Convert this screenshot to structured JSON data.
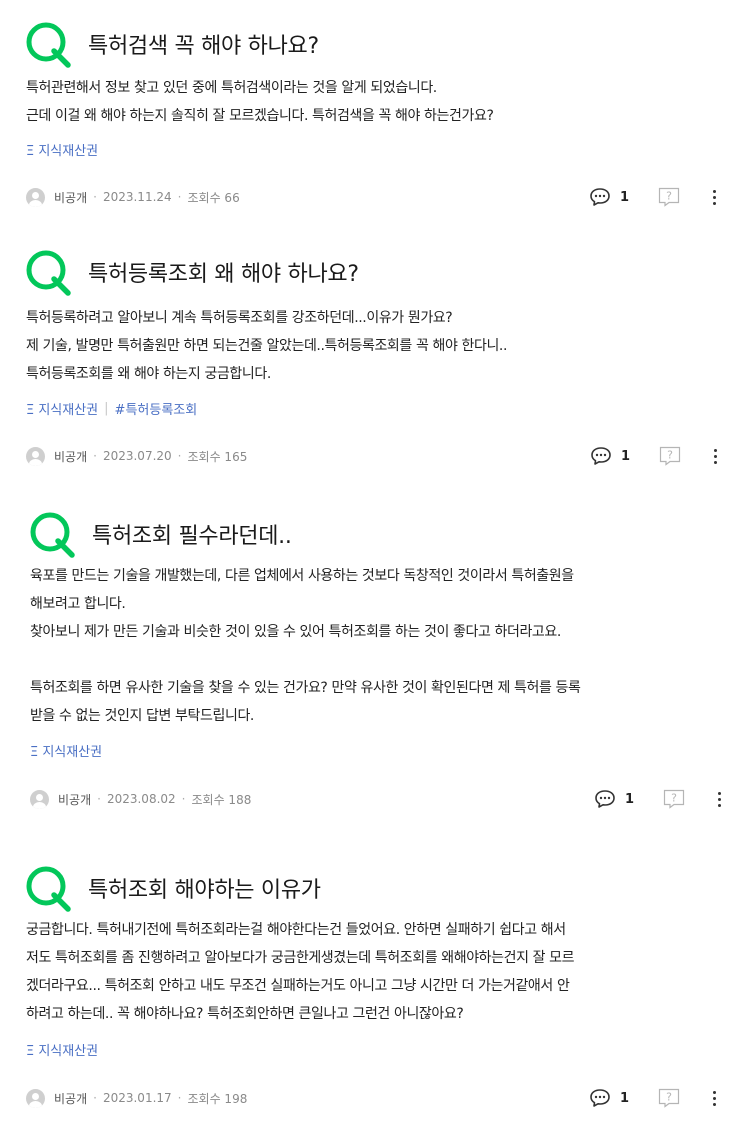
{
  "colors": {
    "accent_green": "#03c75a",
    "tag_blue": "#4a6fc4",
    "meta_gray": "#8a8a8a"
  },
  "icons": {
    "question_mark": "q-logo-icon",
    "answer": "speech-bubble-icon",
    "help": "question-box-icon",
    "more": "kebab-menu-icon",
    "avatar": "default-profile-icon"
  },
  "posts": [
    {
      "title": "특허검색 꼭 해야 하나요?",
      "body": [
        "특허관련해서 정보 찾고 있던 중에 특허검색이라는 것을 알게 되었습니다.",
        "근데 이걸 왜 해야 하는지 솔직히 잘 모르겠습니다. 특허검색을 꼭 해야 하는건가요?"
      ],
      "tags": [
        "Ξ 지식재산권"
      ],
      "author": "비공개",
      "date": "2023.11.24",
      "views": "조회수 66",
      "answers": "1"
    },
    {
      "title": "특허등록조회 왜 해야 하나요?",
      "body": [
        "특허등록하려고 알아보니 계속 특허등록조회를 강조하던데...이유가 뭔가요?",
        "제 기술, 발명만 특허출원만 하면 되는건줄 알았는데..특허등록조회를 꼭 해야 한다니..",
        "특허등록조회를 왜 해야 하는지 궁금합니다."
      ],
      "tags": [
        "Ξ 지식재산권",
        "#특허등록조회"
      ],
      "author": "비공개",
      "date": "2023.07.20",
      "views": "조회수 165",
      "answers": "1"
    },
    {
      "title": "특허조회 필수라던데..",
      "body": [
        "육포를 만드는 기술을 개발했는데, 다른 업체에서 사용하는 것보다 독창적인 것이라서 특허출원을",
        "해보려고 합니다.",
        "찾아보니 제가 만든 기술과 비슷한 것이 있을 수 있어 특허조회를 하는 것이 좋다고 하더라고요.",
        "",
        "특허조회를 하면 유사한 기술을 찾을 수 있는 건가요? 만약 유사한 것이 확인된다면 제 특허를 등록",
        "받을 수 없는 것인지 답변 부탁드립니다."
      ],
      "tags": [
        "Ξ 지식재산권"
      ],
      "author": "비공개",
      "date": "2023.08.02",
      "views": "조회수 188",
      "answers": "1"
    },
    {
      "title": "특허조회 해야하는 이유가",
      "body": [
        "궁금합니다. 특허내기전에 특허조회라는걸 해야한다는건 들었어요.  안하면 실패하기 쉽다고 해서",
        "저도 특허조회를 좀 진행하려고 알아보다가 궁금한게생겼는데 특허조회를 왜해야하는건지 잘 모르",
        "겠더라구요... 특허조회 안하고 내도 무조건 실패하는거도 아니고 그냥 시간만 더 가는거같애서 안",
        "하려고 하는데.. 꼭 해야하나요? 특허조회안하면 큰일나고 그런건 아니잖아요?"
      ],
      "tags": [
        "Ξ 지식재산권"
      ],
      "author": "비공개",
      "date": "2023.01.17",
      "views": "조회수 198",
      "answers": "1"
    }
  ]
}
